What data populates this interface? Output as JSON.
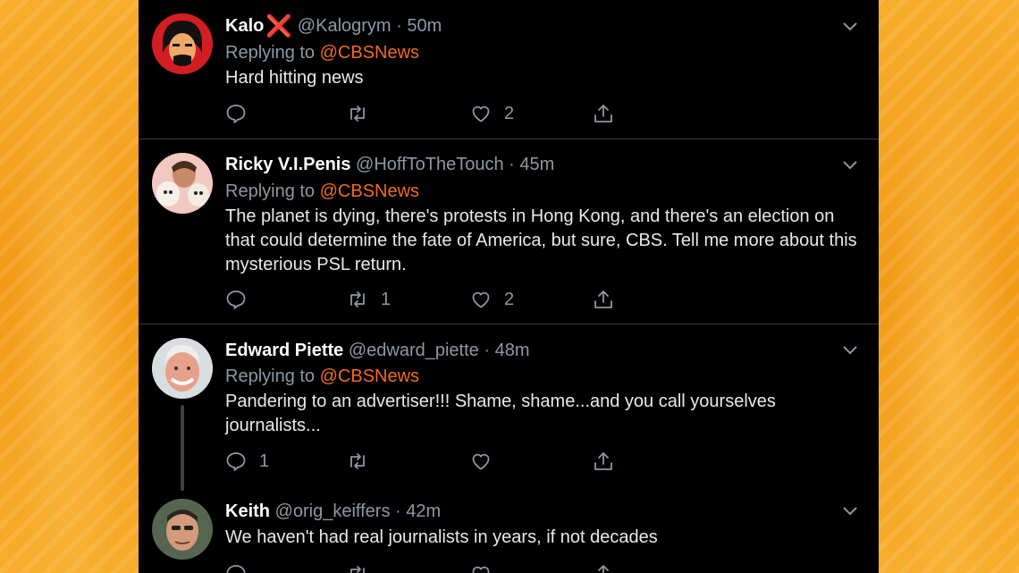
{
  "tweets": [
    {
      "name": "Kalo",
      "badge": "❌",
      "handle": "@Kalogrym",
      "time": "50m",
      "replying_prefix": "Replying to",
      "replying_to": "@CBSNews",
      "text": "Hard hitting news",
      "reply_count": "",
      "retweet_count": "",
      "like_count": "2"
    },
    {
      "name": "Ricky V.I.Penis",
      "handle": "@HoffToTheTouch",
      "time": "45m",
      "replying_prefix": "Replying to",
      "replying_to": "@CBSNews",
      "text": "The planet is dying, there's protests in Hong Kong, and there's an election on that could determine the fate of America, but sure, CBS. Tell me more about this mysterious PSL return.",
      "reply_count": "",
      "retweet_count": "1",
      "like_count": "2"
    },
    {
      "name": "Edward Piette",
      "handle": "@edward_piette",
      "time": "48m",
      "replying_prefix": "Replying to",
      "replying_to": "@CBSNews",
      "text": "Pandering to an advertiser!!! Shame, shame...and you call yourselves journalists...",
      "reply_count": "1",
      "retweet_count": "",
      "like_count": ""
    },
    {
      "name": "Keith",
      "handle": "@orig_keiffers",
      "time": "42m",
      "text": "We haven't had real journalists in years, if not decades",
      "reply_count": "",
      "retweet_count": "",
      "like_count": ""
    }
  ],
  "separator": "·",
  "colors": {
    "background": "#000000",
    "mention": "#f26a21",
    "muted": "#8b98a5",
    "frame_orange": "#f5a623"
  },
  "icons": [
    "reply-icon",
    "retweet-icon",
    "like-icon",
    "share-icon",
    "chevron-down-icon"
  ]
}
